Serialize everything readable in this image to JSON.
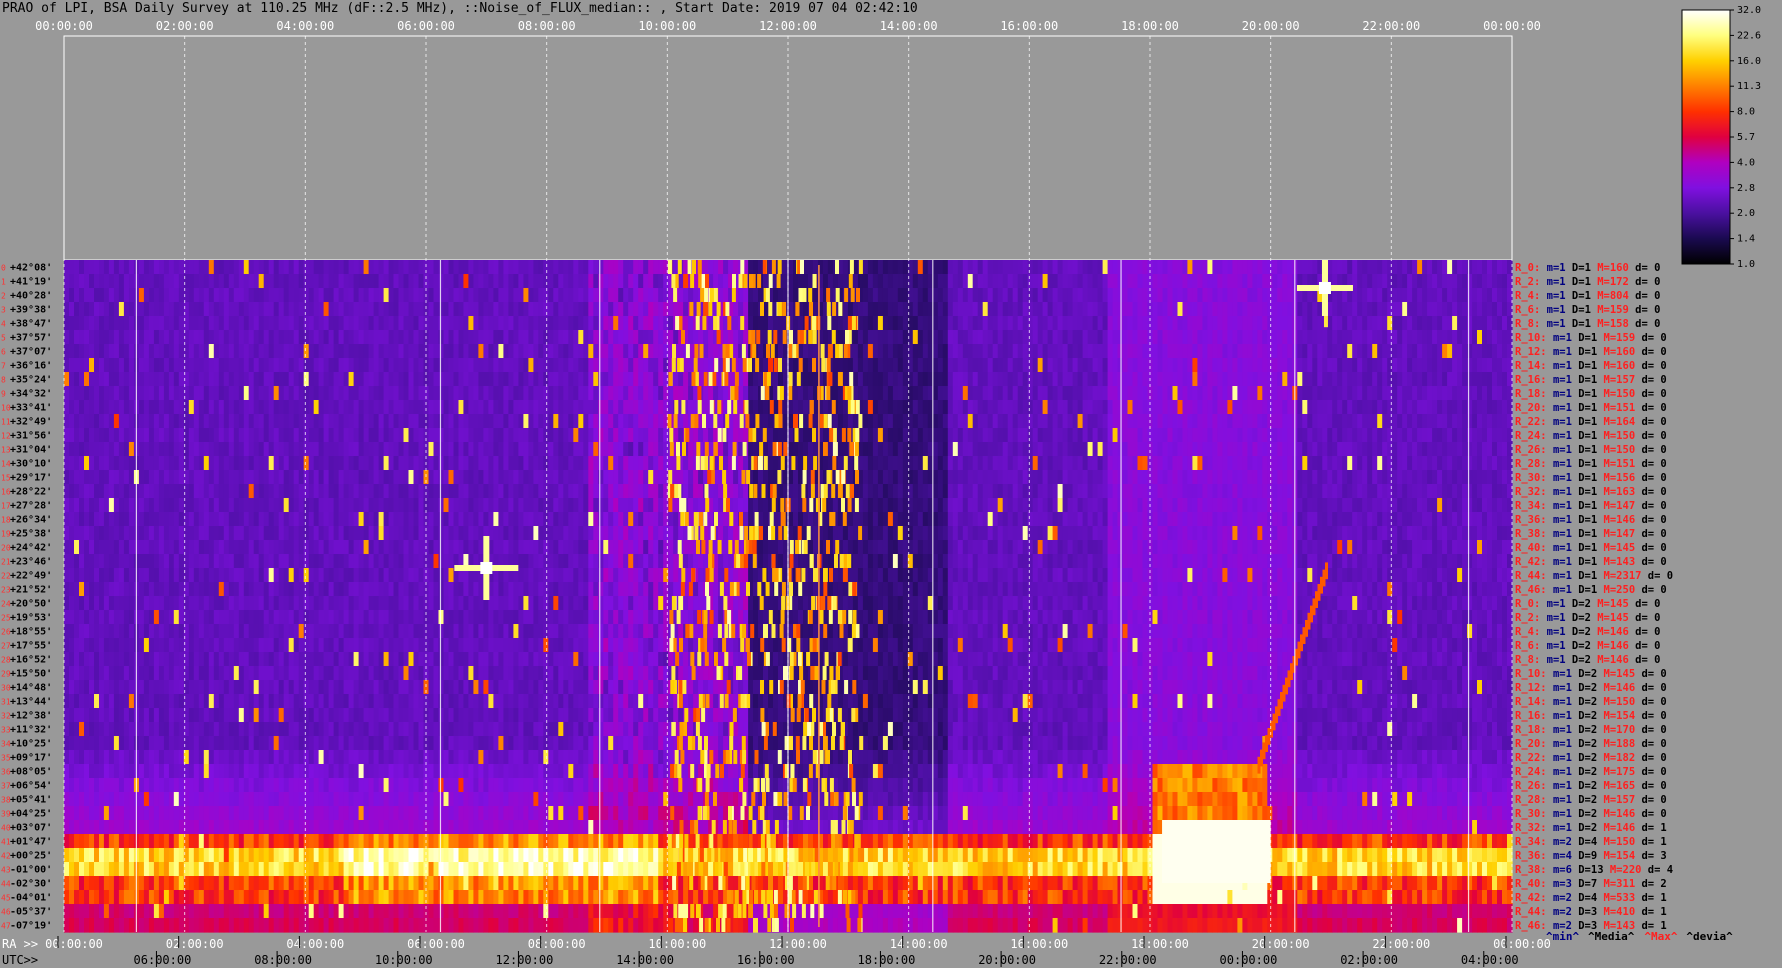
{
  "title": "PRAO of LPI, BSA Daily Survey at 110.25 MHz (dF::2.5 MHz), ::Noise_of_FLUX_median:: , Start Date: 2019 07 04 02:42:10",
  "colors": {
    "background": "#999999",
    "info_prefix": "#ff2020",
    "info_value": "#000080"
  },
  "chart_data": {
    "type": "heatmap",
    "title": "PRAO of LPI, BSA Daily Survey at 110.25 MHz (dF::2.5 MHz), ::Noise_of_FLUX_median:: , Start Date: 2019 07 04 02:42:10",
    "x_top_ticks": [
      "00:00:00",
      "02:00:00",
      "04:00:00",
      "06:00:00",
      "08:00:00",
      "10:00:00",
      "12:00:00",
      "14:00:00",
      "16:00:00",
      "18:00:00",
      "20:00:00",
      "22:00:00",
      "00:00:00"
    ],
    "ra_axis_prefix": "RA >>",
    "ra_ticks": [
      "00:00:00",
      "02:00:00",
      "04:00:00",
      "06:00:00",
      "08:00:00",
      "10:00:00",
      "12:00:00",
      "14:00:00",
      "16:00:00",
      "18:00:00",
      "20:00:00",
      "22:00:00",
      "00:00:00"
    ],
    "utc_axis_label": "UTC>>",
    "utc_ticks": [
      "04:00:00",
      "06:00:00",
      "08:00:00",
      "10:00:00",
      "12:00:00",
      "14:00:00",
      "16:00:00",
      "18:00:00",
      "20:00:00",
      "22:00:00",
      "00:00:00",
      "02:00:00"
    ],
    "dec_labels": [
      "+42°08'",
      "+41°19'",
      "+40°28'",
      "+39°38'",
      "+38°47'",
      "+37°57'",
      "+37°07'",
      "+36°16'",
      "+35°24'",
      "+34°32'",
      "+33°41'",
      "+32°49'",
      "+31°56'",
      "+31°04'",
      "+30°10'",
      "+29°17'",
      "+28°22'",
      "+27°28'",
      "+26°34'",
      "+25°38'",
      "+24°42'",
      "+23°46'",
      "+22°49'",
      "+21°52'",
      "+20°50'",
      "+19°53'",
      "+18°55'",
      "+17°55'",
      "+16°52'",
      "+15°50'",
      "+14°48'",
      "+13°44'",
      "+12°38'",
      "+11°32'",
      "+10°25'",
      "+09°17'",
      "+08°05'",
      "+06°54'",
      "+05°41'",
      "+04°25'",
      "+03°07'",
      "+01°47'",
      "+00°25'",
      "-01°00'",
      "-02°30'",
      "-04°01'",
      "-05°37'",
      "-07°19'"
    ],
    "row_index_labels": [
      "0",
      "1",
      "2",
      "3",
      "4",
      "5",
      "6",
      "7",
      "8",
      "9",
      "10",
      "11",
      "12",
      "13",
      "14",
      "15",
      "16",
      "17",
      "18",
      "19",
      "20",
      "21",
      "22",
      "23",
      "24",
      "25",
      "26",
      "27",
      "28",
      "29",
      "30",
      "31",
      "32",
      "33",
      "34",
      "35",
      "36",
      "37",
      "38",
      "39",
      "40",
      "41",
      "42",
      "43",
      "44",
      "45",
      "46",
      "47"
    ],
    "colorbar": {
      "ticks": [
        "32.0",
        "22.6",
        "16.0",
        "11.3",
        "8.0",
        "5.7",
        "4.0",
        "2.8",
        "2.0",
        "1.4",
        "1.0"
      ],
      "scale": "log",
      "range": [
        1.0,
        32.0
      ],
      "colormap": [
        "#000000",
        "#1a0a50",
        "#4a10a0",
        "#8010e0",
        "#b000c0",
        "#e00040",
        "#ff3000",
        "#ff8000",
        "#ffd000",
        "#ffff80",
        "#ffffff"
      ]
    },
    "stats": [
      {
        "r": "R_0:",
        "m": "m=1",
        "D": "D=1",
        "M": "M=160",
        "d": "d= 0"
      },
      {
        "r": "R_2:",
        "m": "m=1",
        "D": "D=1",
        "M": "M=172",
        "d": "d= 0"
      },
      {
        "r": "R_4:",
        "m": "m=1",
        "D": "D=1",
        "M": "M=804",
        "d": "d= 0"
      },
      {
        "r": "R_6:",
        "m": "m=1",
        "D": "D=1",
        "M": "M=159",
        "d": "d= 0"
      },
      {
        "r": "R_8:",
        "m": "m=1",
        "D": "D=1",
        "M": "M=158",
        "d": "d= 0"
      },
      {
        "r": "R_10:",
        "m": "m=1",
        "D": "D=1",
        "M": "M=159",
        "d": "d= 0"
      },
      {
        "r": "R_12:",
        "m": "m=1",
        "D": "D=1",
        "M": "M=160",
        "d": "d= 0"
      },
      {
        "r": "R_14:",
        "m": "m=1",
        "D": "D=1",
        "M": "M=160",
        "d": "d= 0"
      },
      {
        "r": "R_16:",
        "m": "m=1",
        "D": "D=1",
        "M": "M=157",
        "d": "d= 0"
      },
      {
        "r": "R_18:",
        "m": "m=1",
        "D": "D=1",
        "M": "M=150",
        "d": "d= 0"
      },
      {
        "r": "R_20:",
        "m": "m=1",
        "D": "D=1",
        "M": "M=151",
        "d": "d= 0"
      },
      {
        "r": "R_22:",
        "m": "m=1",
        "D": "D=1",
        "M": "M=164",
        "d": "d= 0"
      },
      {
        "r": "R_24:",
        "m": "m=1",
        "D": "D=1",
        "M": "M=150",
        "d": "d= 0"
      },
      {
        "r": "R_26:",
        "m": "m=1",
        "D": "D=1",
        "M": "M=150",
        "d": "d= 0"
      },
      {
        "r": "R_28:",
        "m": "m=1",
        "D": "D=1",
        "M": "M=151",
        "d": "d= 0"
      },
      {
        "r": "R_30:",
        "m": "m=1",
        "D": "D=1",
        "M": "M=156",
        "d": "d= 0"
      },
      {
        "r": "R_32:",
        "m": "m=1",
        "D": "D=1",
        "M": "M=163",
        "d": "d= 0"
      },
      {
        "r": "R_34:",
        "m": "m=1",
        "D": "D=1",
        "M": "M=147",
        "d": "d= 0"
      },
      {
        "r": "R_36:",
        "m": "m=1",
        "D": "D=1",
        "M": "M=146",
        "d": "d= 0"
      },
      {
        "r": "R_38:",
        "m": "m=1",
        "D": "D=1",
        "M": "M=147",
        "d": "d= 0"
      },
      {
        "r": "R_40:",
        "m": "m=1",
        "D": "D=1",
        "M": "M=145",
        "d": "d= 0"
      },
      {
        "r": "R_42:",
        "m": "m=1",
        "D": "D=1",
        "M": "M=143",
        "d": "d= 0"
      },
      {
        "r": "R_44:",
        "m": "m=1",
        "D": "D=1",
        "M": "M=2317",
        "d": "d= 0"
      },
      {
        "r": "R_46:",
        "m": "m=1",
        "D": "D=1",
        "M": "M=250",
        "d": "d= 0"
      },
      {
        "r": "R_0:",
        "m": "m=1",
        "D": "D=2",
        "M": "M=145",
        "d": "d= 0"
      },
      {
        "r": "R_2:",
        "m": "m=1",
        "D": "D=2",
        "M": "M=145",
        "d": "d= 0"
      },
      {
        "r": "R_4:",
        "m": "m=1",
        "D": "D=2",
        "M": "M=146",
        "d": "d= 0"
      },
      {
        "r": "R_6:",
        "m": "m=1",
        "D": "D=2",
        "M": "M=146",
        "d": "d= 0"
      },
      {
        "r": "R_8:",
        "m": "m=1",
        "D": "D=2",
        "M": "M=146",
        "d": "d= 0"
      },
      {
        "r": "R_10:",
        "m": "m=1",
        "D": "D=2",
        "M": "M=145",
        "d": "d= 0"
      },
      {
        "r": "R_12:",
        "m": "m=1",
        "D": "D=2",
        "M": "M=146",
        "d": "d= 0"
      },
      {
        "r": "R_14:",
        "m": "m=1",
        "D": "D=2",
        "M": "M=150",
        "d": "d= 0"
      },
      {
        "r": "R_16:",
        "m": "m=1",
        "D": "D=2",
        "M": "M=154",
        "d": "d= 0"
      },
      {
        "r": "R_18:",
        "m": "m=1",
        "D": "D=2",
        "M": "M=170",
        "d": "d= 0"
      },
      {
        "r": "R_20:",
        "m": "m=1",
        "D": "D=2",
        "M": "M=188",
        "d": "d= 0"
      },
      {
        "r": "R_22:",
        "m": "m=1",
        "D": "D=2",
        "M": "M=182",
        "d": "d= 0"
      },
      {
        "r": "R_24:",
        "m": "m=1",
        "D": "D=2",
        "M": "M=175",
        "d": "d= 0"
      },
      {
        "r": "R_26:",
        "m": "m=1",
        "D": "D=2",
        "M": "M=165",
        "d": "d= 0"
      },
      {
        "r": "R_28:",
        "m": "m=1",
        "D": "D=2",
        "M": "M=157",
        "d": "d= 0"
      },
      {
        "r": "R_30:",
        "m": "m=1",
        "D": "D=2",
        "M": "M=146",
        "d": "d= 0"
      },
      {
        "r": "R_32:",
        "m": "m=1",
        "D": "D=2",
        "M": "M=146",
        "d": "d= 1"
      },
      {
        "r": "R_34:",
        "m": "m=2",
        "D": "D=4",
        "M": "M=150",
        "d": "d= 1"
      },
      {
        "r": "R_36:",
        "m": "m=4",
        "D": "D=9",
        "M": "M=154",
        "d": "d= 3"
      },
      {
        "r": "R_38:",
        "m": "m=6",
        "D": "D=13",
        "M": "M=220",
        "d": "d= 4"
      },
      {
        "r": "R_40:",
        "m": "m=3",
        "D": "D=7",
        "M": "M=311",
        "d": "d= 2"
      },
      {
        "r": "R_42:",
        "m": "m=2",
        "D": "D=4",
        "M": "M=533",
        "d": "d= 1"
      },
      {
        "r": "R_44:",
        "m": "m=2",
        "D": "D=3",
        "M": "M=410",
        "d": "d= 1"
      },
      {
        "r": "R_46:",
        "m": "m=2",
        "D": "D=3",
        "M": "M=143",
        "d": "d= 1"
      }
    ],
    "legend": [
      {
        "label": "^min^",
        "color": "#000080"
      },
      {
        "label": "^Media^",
        "color": "#000000"
      },
      {
        "label": "^Max^",
        "color": "#ff2020"
      },
      {
        "label": "^devia^",
        "color": "#000000"
      }
    ]
  }
}
